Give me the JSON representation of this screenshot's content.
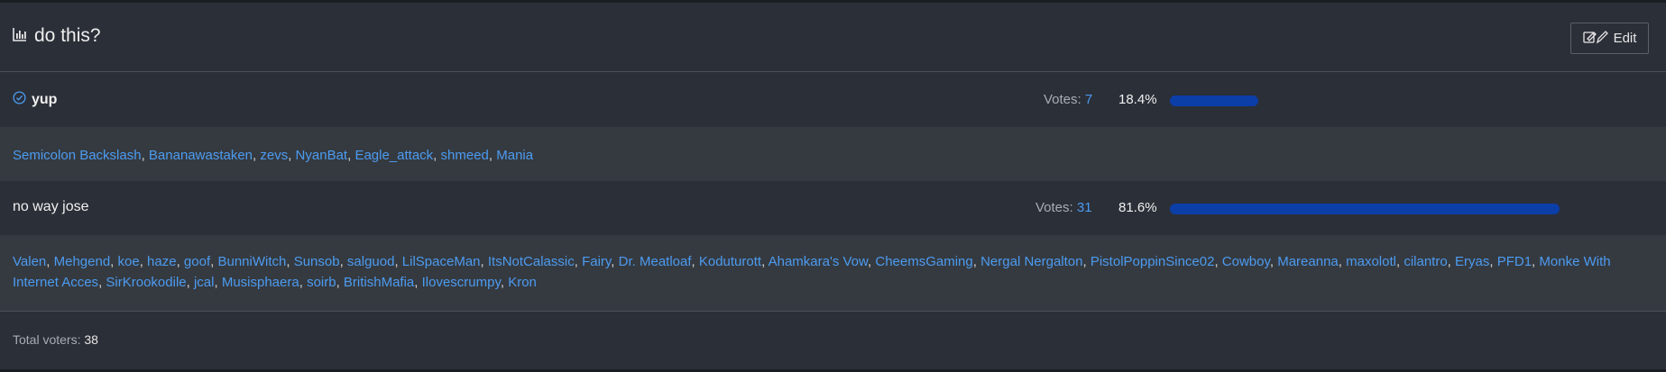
{
  "poll": {
    "title": "do this?",
    "edit_label": "Edit",
    "options": [
      {
        "label": "yup",
        "selected": true,
        "votes_label": "Votes: ",
        "votes": "7",
        "percent": "18.4%",
        "fraction": 0.184,
        "voters": [
          "Semicolon Backslash",
          "Bananawastaken",
          "zevs",
          "NyanBat",
          "Eagle_attack",
          "shmeed",
          "Mania"
        ]
      },
      {
        "label": "no way jose",
        "selected": false,
        "votes_label": "Votes: ",
        "votes": "31",
        "percent": "81.6%",
        "fraction": 0.816,
        "voters": [
          "Valen",
          "Mehgend",
          "koe",
          "haze",
          "goof",
          "BunniWitch",
          "Sunsob",
          "salguod",
          "LilSpaceMan",
          "ItsNotCalassic",
          "Fairy",
          "Dr. Meatloaf",
          "Koduturott",
          "Ahamkara's Vow",
          "CheemsGaming",
          "Nergal Nergalton",
          "PistolPoppinSince02",
          "Cowboy",
          "Mareanna",
          "maxolotl",
          "cilantro",
          "Eryas",
          "PFD1",
          "Monke With Internet Acces",
          "SirKrookodile",
          "jcal",
          "Musisphaera",
          "soirb",
          "BritishMafia",
          "Ilovescrumpy",
          "Kron"
        ]
      }
    ],
    "total_label": "Total voters: ",
    "total": "38"
  },
  "colors": {
    "accent": "#4c9bf0",
    "bar": "#0c3ea8",
    "background": "#2b2f38"
  }
}
